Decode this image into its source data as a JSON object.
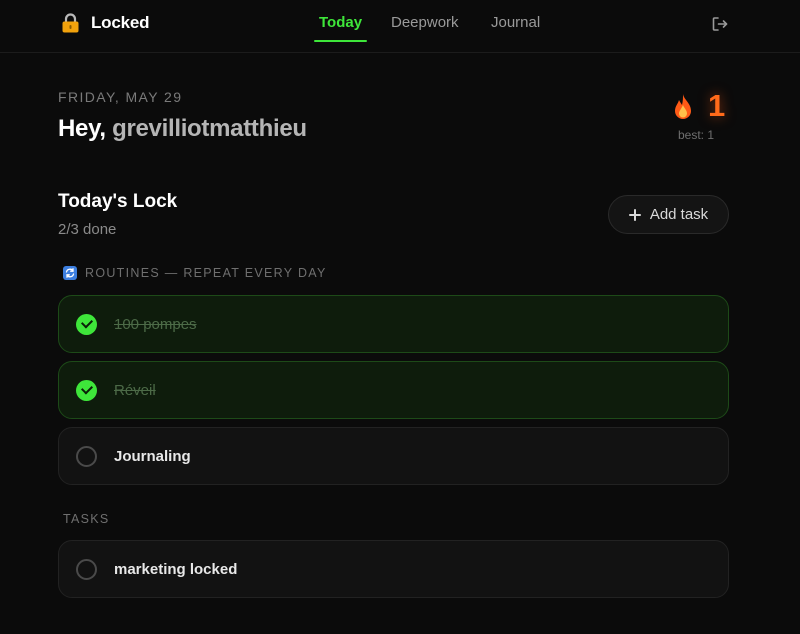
{
  "app": {
    "name": "Locked",
    "icon": "lock-icon"
  },
  "nav": {
    "tabs": [
      {
        "label": "Today",
        "active": true
      },
      {
        "label": "Deepwork",
        "active": false
      },
      {
        "label": "Journal",
        "active": false
      }
    ],
    "logout_icon": "logout-icon"
  },
  "header": {
    "date": "FRIDAY, MAY 29",
    "greeting": "Hey,",
    "username": "grevilliotmatthieu"
  },
  "streak": {
    "count": "1",
    "best": "best: 1",
    "icon": "flame-icon"
  },
  "today": {
    "title": "Today's Lock",
    "progress": "2/3 done",
    "add_label": "Add task"
  },
  "routines": {
    "label": "ROUTINES — REPEAT EVERY DAY",
    "icon": "repeat-icon",
    "items": [
      {
        "label": "100 pompes",
        "done": true
      },
      {
        "label": "Réveil",
        "done": true
      },
      {
        "label": "Journaling",
        "done": false
      }
    ]
  },
  "tasks": {
    "label": "TASKS",
    "items": [
      {
        "label": "marketing locked",
        "done": false
      }
    ]
  },
  "colors": {
    "accent": "#3ee63a",
    "streak": "#ff6a1a",
    "background": "#0b0b0b",
    "done_card": "#0e1c0c"
  }
}
